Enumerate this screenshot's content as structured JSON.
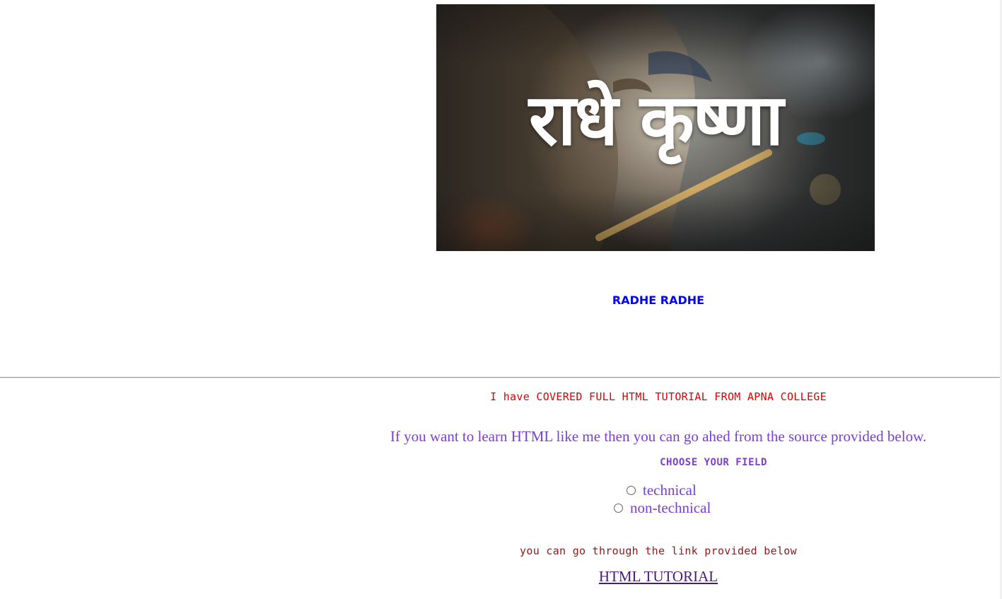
{
  "banner": {
    "title": "राधे कृष्णा"
  },
  "heading": "RADHE RADHE",
  "covered_text": "I have COVERED FULL HTML TUTORIAL FROM APNA COLLEGE",
  "learn_text": "If you want to learn HTML like me then you can go ahed from the source provided below.",
  "choose_label": "CHOOSE YOUR FIELD",
  "options": [
    {
      "label": "technical"
    },
    {
      "label": "non-technical"
    }
  ],
  "link_intro": "you can go through the link provided below",
  "link_text": "HTML TUTORIAL",
  "colors": {
    "heading": "#0000ff",
    "covered": "#e00000",
    "purple": "#7b3fd0",
    "link": "#4b1a7a"
  }
}
